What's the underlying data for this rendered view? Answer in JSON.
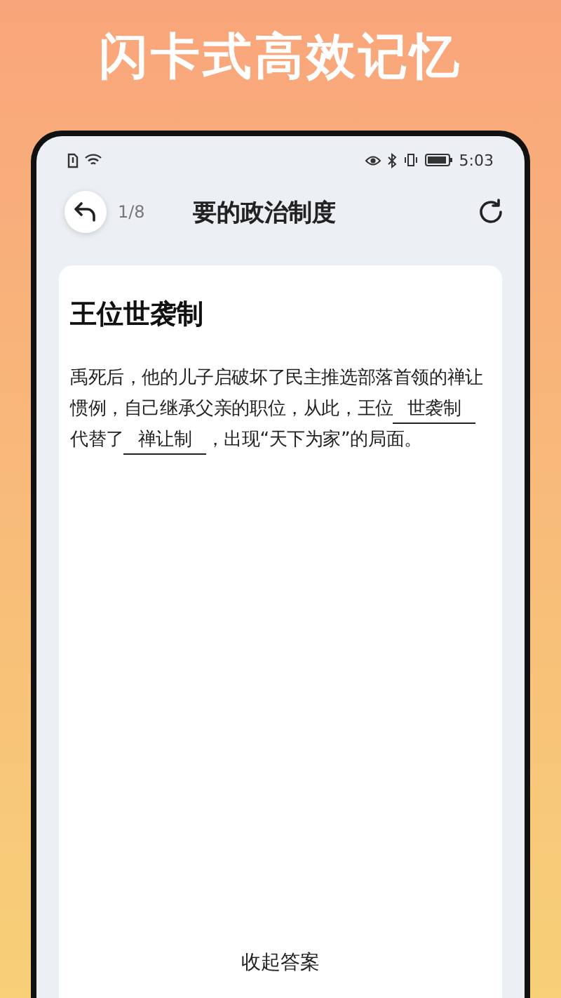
{
  "headline": "闪卡式高效记忆",
  "status_bar": {
    "time": "5:03"
  },
  "header": {
    "progress": "1/8",
    "title": "要的政治制度"
  },
  "card": {
    "title": "王位世袭制",
    "segments": [
      {
        "kind": "text",
        "text": "禹死后，他的儿子启破坏了民主推选部落首领的禅让惯例，自己继承父亲的职位，从此，王位"
      },
      {
        "kind": "blank",
        "text": "世袭制"
      },
      {
        "kind": "text",
        "text": "代替了"
      },
      {
        "kind": "blank",
        "text": "禅让制"
      },
      {
        "kind": "text",
        "text": "，出现“天下为家”的局面。"
      }
    ],
    "toggle_label": "收起答案"
  }
}
